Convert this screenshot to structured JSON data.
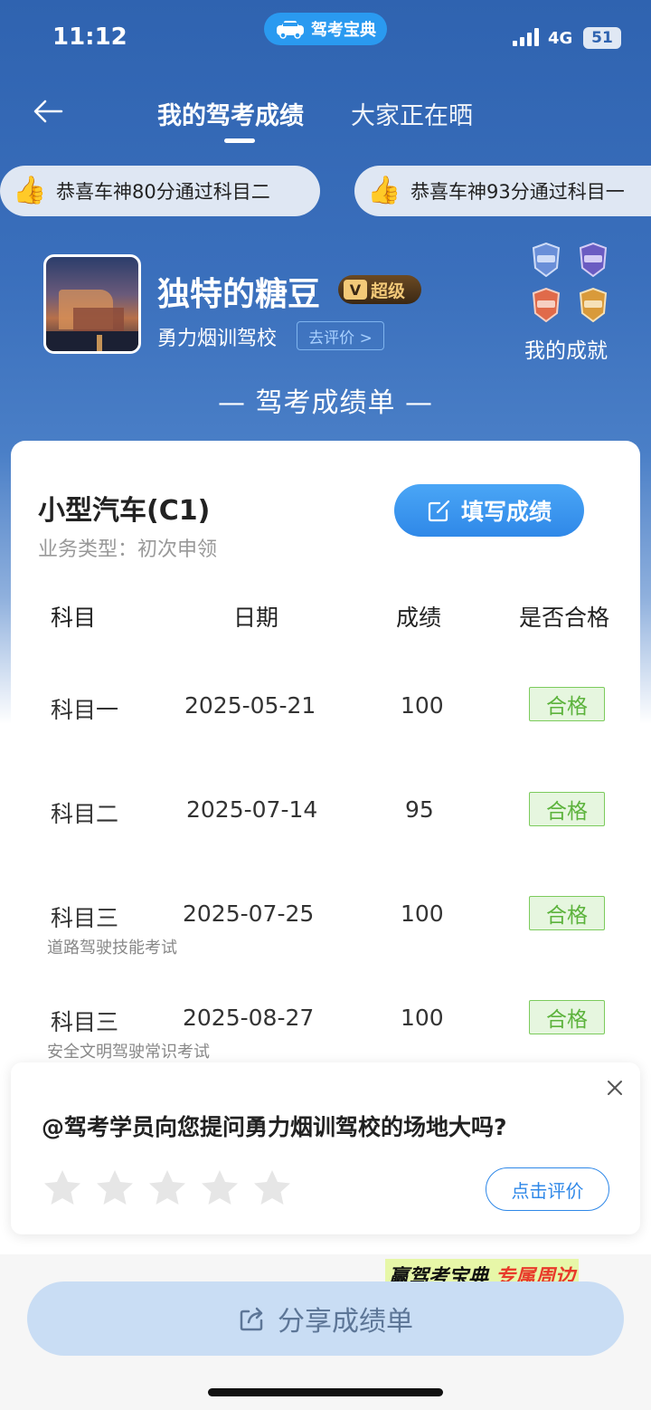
{
  "status_bar": {
    "time": "11:12",
    "app_name": "驾考宝典",
    "network": "4G",
    "battery": "51"
  },
  "nav": {
    "tabs": [
      {
        "label": "我的驾考成绩",
        "active": true
      },
      {
        "label": "大家正在晒",
        "active": false
      }
    ]
  },
  "ticker": [
    "恭喜车神80分通过科目二",
    "恭喜车神93分通过科目一"
  ],
  "profile": {
    "name": "独特的糖豆",
    "vip_badge": "超级",
    "vip_letter": "V",
    "school": "勇力烟训驾校",
    "rate_button": "去评价 >",
    "achievements_label": "我的成就"
  },
  "sheet_title": "— 驾考成绩单 —",
  "card": {
    "vehicle": "小型汽车(C1)",
    "business_type": "业务类型：初次申领",
    "fill_button": "填写成绩",
    "headers": [
      "科目",
      "日期",
      "成绩",
      "是否合格"
    ],
    "rows": [
      {
        "subject": "科目一",
        "date": "2025-05-21",
        "score": "100",
        "status": "合格",
        "note": ""
      },
      {
        "subject": "科目二",
        "date": "2025-07-14",
        "score": "95",
        "status": "合格",
        "note": ""
      },
      {
        "subject": "科目三",
        "date": "2025-07-25",
        "score": "100",
        "status": "合格",
        "note": "道路驾驶技能考试"
      },
      {
        "subject": "科目三",
        "date": "2025-08-27",
        "score": "100",
        "status": "合格",
        "note": "安全文明驾驶常识考试"
      }
    ]
  },
  "popup": {
    "question": "@驾考学员向您提问勇力烟训驾校的场地大吗?",
    "rating": 0,
    "max_rating": 5,
    "eval_button": "点击评价"
  },
  "promo": {
    "part1": "赢驾考宝典",
    "part2": "专属周边"
  },
  "share_button": "分享成绩单",
  "colors": {
    "primary_blue": "#2f63b0",
    "button_blue": "#2f88e8",
    "pass_green": "#5cb33c",
    "promo_red": "#e83b2b"
  }
}
